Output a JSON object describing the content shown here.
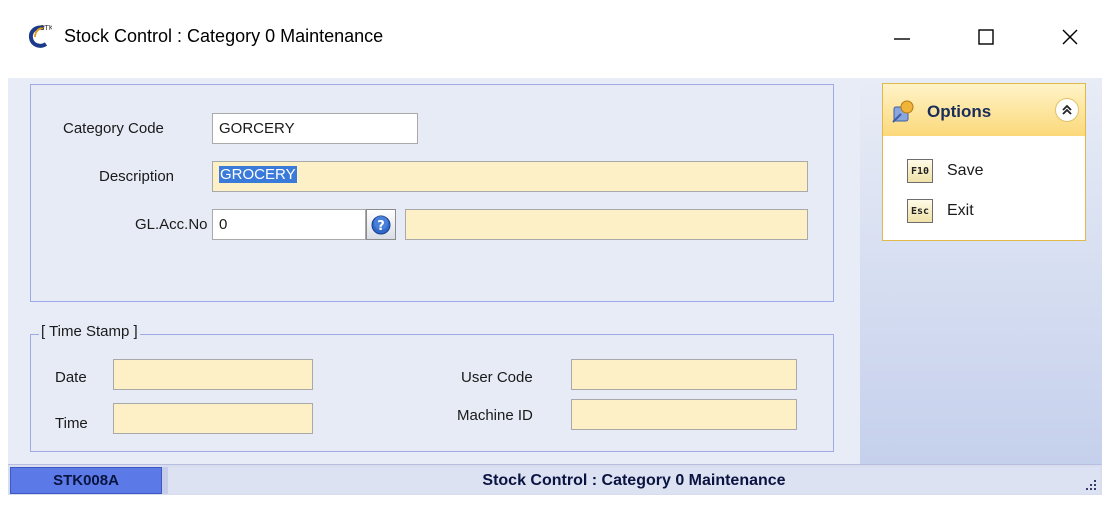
{
  "window": {
    "title": "Stock Control : Category 0 Maintenance",
    "app_icon": "stk-app-icon",
    "controls": {
      "minimize": "minimize-icon",
      "maximize": "maximize-icon",
      "close": "close-icon"
    }
  },
  "form": {
    "category_code": {
      "label": "Category Code",
      "value": "GORCERY"
    },
    "description": {
      "label": "Description",
      "value": "GROCERY"
    },
    "gl_acc_no": {
      "label": "GL.Acc.No",
      "value": "0",
      "lookup_icon": "help-lookup-icon",
      "name_value": ""
    }
  },
  "timestamp": {
    "legend": "[ Time Stamp ]",
    "date": {
      "label": "Date",
      "value": ""
    },
    "time": {
      "label": "Time",
      "value": ""
    },
    "user_code": {
      "label": "User Code",
      "value": ""
    },
    "machine_id": {
      "label": "Machine ID",
      "value": ""
    }
  },
  "options": {
    "title": "Options",
    "icon": "options-icon",
    "collapse_icon": "chevron-up-double-icon",
    "items": [
      {
        "key": "F10",
        "label": "Save"
      },
      {
        "key": "Esc",
        "label": "Exit"
      }
    ]
  },
  "statusbar": {
    "code": "STK008A",
    "title": "Stock Control : Category 0 Maintenance"
  },
  "colors": {
    "client_bg": "#e7ecf6",
    "field_highlight": "#fdefc6",
    "selection": "#3a7ad9",
    "status_code_bg": "#5b7ae8",
    "options_header": "#fbd97a"
  }
}
